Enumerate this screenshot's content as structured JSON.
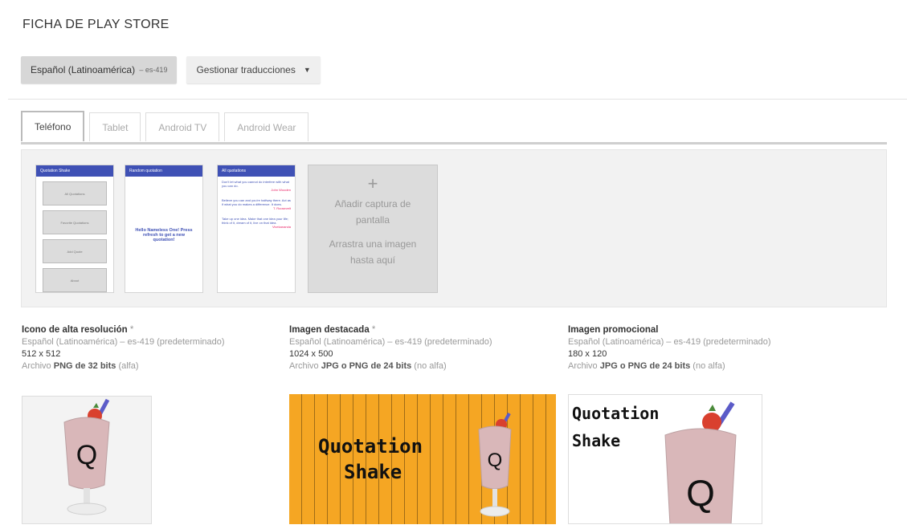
{
  "section_title": "FICHA DE PLAY STORE",
  "languages": {
    "active_label": "Español (Latinoamérica)",
    "active_code": "– es-419",
    "manage_label": "Gestionar traducciones",
    "manage_caret": "▼"
  },
  "tabs": [
    {
      "label": "Teléfono",
      "selected": true
    },
    {
      "label": "Tablet",
      "selected": false
    },
    {
      "label": "Android TV",
      "selected": false
    },
    {
      "label": "Android Wear",
      "selected": false
    }
  ],
  "screenshots": {
    "thumb1": {
      "bar": "Quotation Shake",
      "buttons": [
        "All Quotations",
        "Favorite Quotations",
        "Add Quote",
        "About"
      ]
    },
    "thumb2": {
      "bar": "Random quotation",
      "text": "Hello Nameless One! Press refresh to get a new quotation!"
    },
    "thumb3": {
      "bar": "All quotations",
      "quotes": [
        {
          "text": "Don't let what you cannot do interfere with what you can do.",
          "author": "John Wooden"
        },
        {
          "text": "Believe you can and you're halfway there. Act as if what you do makes a difference. It does.",
          "author": "T. Roosevelt"
        },
        {
          "text": "Take up one idea. Make that one idea your life; think of it, dream of it, live on that idea.",
          "author": "Vivekananda"
        }
      ]
    },
    "add": {
      "plus": "+",
      "line1": "Añadir captura de pantalla",
      "line2": "Arrastra una imagen hasta aquí"
    }
  },
  "assets": [
    {
      "title": "Icono de alta resolución",
      "required": "*",
      "lang": "Español (Latinoamérica) – es-419 (predeterminado)",
      "size": "512 x 512",
      "file_prefix": "Archivo",
      "file_format": "PNG de 32 bits",
      "file_suffix": "(alfa)"
    },
    {
      "title": "Imagen destacada",
      "required": "*",
      "lang": "Español (Latinoamérica) – es-419 (predeterminado)",
      "size": "1024 x 500",
      "file_prefix": "Archivo",
      "file_format": "JPG o PNG de 24 bits",
      "file_suffix": "(no alfa)"
    },
    {
      "title": "Imagen promocional",
      "required": "",
      "lang": "Español (Latinoamérica) – es-419 (predeterminado)",
      "size": "180 x 120",
      "file_prefix": "Archivo",
      "file_format": "JPG o PNG de 24 bits",
      "file_suffix": "(no alfa)"
    }
  ],
  "artwork": {
    "word1": "Quotation",
    "word2": "Shake",
    "letter": "Q",
    "colors": {
      "feature_bg": "#f5a623",
      "shake": "#d9b7b9",
      "straw": "#5b5bc8",
      "berry": "#d9402e",
      "toolbar": "#3f51b5"
    }
  }
}
